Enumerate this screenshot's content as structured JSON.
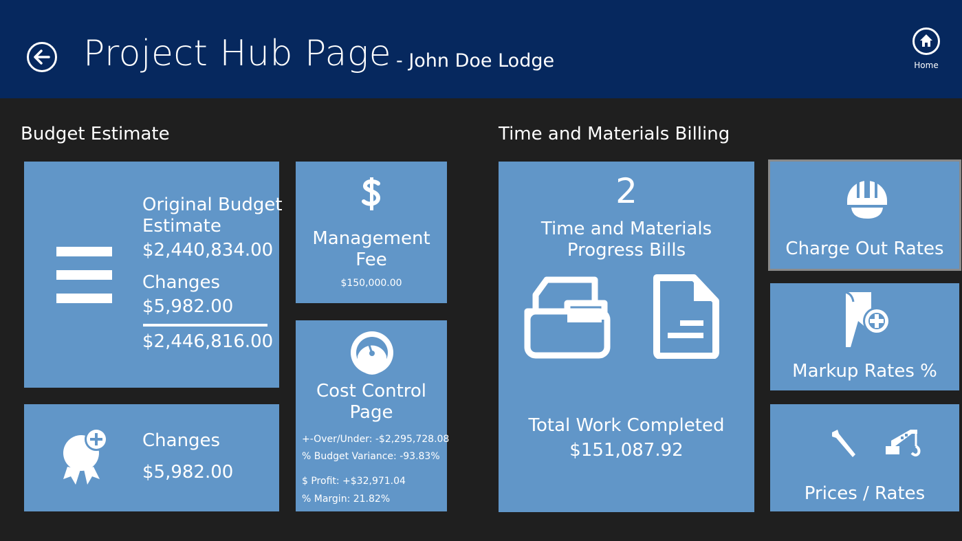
{
  "header": {
    "title": "Project Hub Page",
    "project_name": "- John Doe Lodge",
    "home_label": "Home"
  },
  "budget": {
    "section_title": "Budget Estimate",
    "original": {
      "label_line1": "Original Budget",
      "label_line2": "Estimate",
      "amount": "$2,440,834.00",
      "changes_label": "Changes",
      "changes_amount": "$5,982.00",
      "total": "$2,446,816.00"
    },
    "management_fee": {
      "label_line1": "Management",
      "label_line2": "Fee",
      "amount": "$150,000.00"
    },
    "changes": {
      "label": "Changes",
      "amount": "$5,982.00"
    },
    "cost_control": {
      "label_line1": "Cost Control",
      "label_line2": "Page",
      "over_under": "+-Over/Under:  -$2,295,728.08",
      "budget_variance": "% Budget Variance:  -93.83%",
      "profit": "$ Profit:  +$32,971.04",
      "margin": "% Margin:  21.82%"
    }
  },
  "tm_billing": {
    "section_title": "Time and Materials Billing",
    "progress_bills": {
      "count": "2",
      "label_line1": "Time and Materials",
      "label_line2": "Progress Bills",
      "total_label": "Total Work Completed",
      "total_amount": "$151,087.92"
    },
    "charge_out": {
      "label": "Charge Out Rates"
    },
    "markup": {
      "label": "Markup Rates %"
    },
    "prices": {
      "label": "Prices / Rates"
    }
  },
  "colors": {
    "header_bg": "#06285e",
    "page_bg": "#1f1f1f",
    "tile_bg": "#6196c8"
  },
  "icons": [
    "back-arrow-icon",
    "home-icon",
    "menu-lines-icon",
    "dollar-icon",
    "award-plus-icon",
    "gauge-icon",
    "folder-icon",
    "document-icon",
    "hard-hat-icon",
    "bookmark-plus-icon",
    "wrench-icon",
    "crane-icon"
  ]
}
